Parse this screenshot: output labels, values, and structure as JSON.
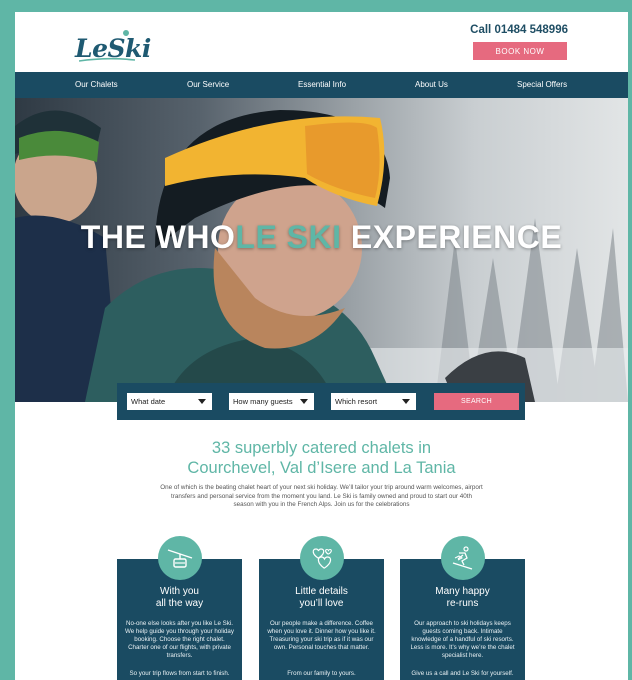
{
  "brand": {
    "logo_text": "LeSki"
  },
  "header": {
    "phone": "Call 01484 548996",
    "book_label": "BOOK NOW"
  },
  "nav": {
    "items": [
      "Our Chalets",
      "Our Service",
      "Essential Info",
      "About Us",
      "Special Offers"
    ]
  },
  "hero": {
    "title_part1": "THE WHO",
    "title_accent": "LE SKI",
    "title_part2": " EXPERIENCE"
  },
  "search": {
    "date_value": "What date",
    "guests_value": "How many guests",
    "resort_value": "Which resort",
    "button_label": "SEARCH"
  },
  "intro": {
    "headline_line1": "33 superbly catered chalets in",
    "headline_line2": "Courchevel, Val d’Isere and La Tania",
    "body": "One of which is the beating chalet heart of your next ski holiday. We’ll tailor your trip around warm welcomes, airport transfers and personal service from the moment you land. Le Ski is family owned and proud to start our 40th season with you in the French Alps. Join us for the celebrations"
  },
  "cards": [
    {
      "title_line1": "With you",
      "title_line2": "all the way",
      "body": "No-one else looks after you like Le Ski. We help guide you through your holiday booking. Choose the right chalet. Charter one of our flights, with private transfers.",
      "foot": "So your trip flows from start to finish."
    },
    {
      "title_line1": "Little details",
      "title_line2": "you’ll love",
      "body": "Our people make a difference. Coffee when you love it. Dinner how you like it. Treasuring your ski trip as if it was our own. Personal touches that matter.",
      "foot": "From our family to yours."
    },
    {
      "title_line1": "Many happy",
      "title_line2": "re-runs",
      "body": "Our approach to ski holidays keeps guests coming back. Intimate knowledge of a handful of ski resorts. Less is more. It’s why we’re the chalet specialist here.",
      "foot": "Give us a call and Le Ski for yourself."
    }
  ],
  "colors": {
    "teal": "#5fb6a6",
    "navy": "#1a4b62",
    "pink": "#e66a7f"
  }
}
